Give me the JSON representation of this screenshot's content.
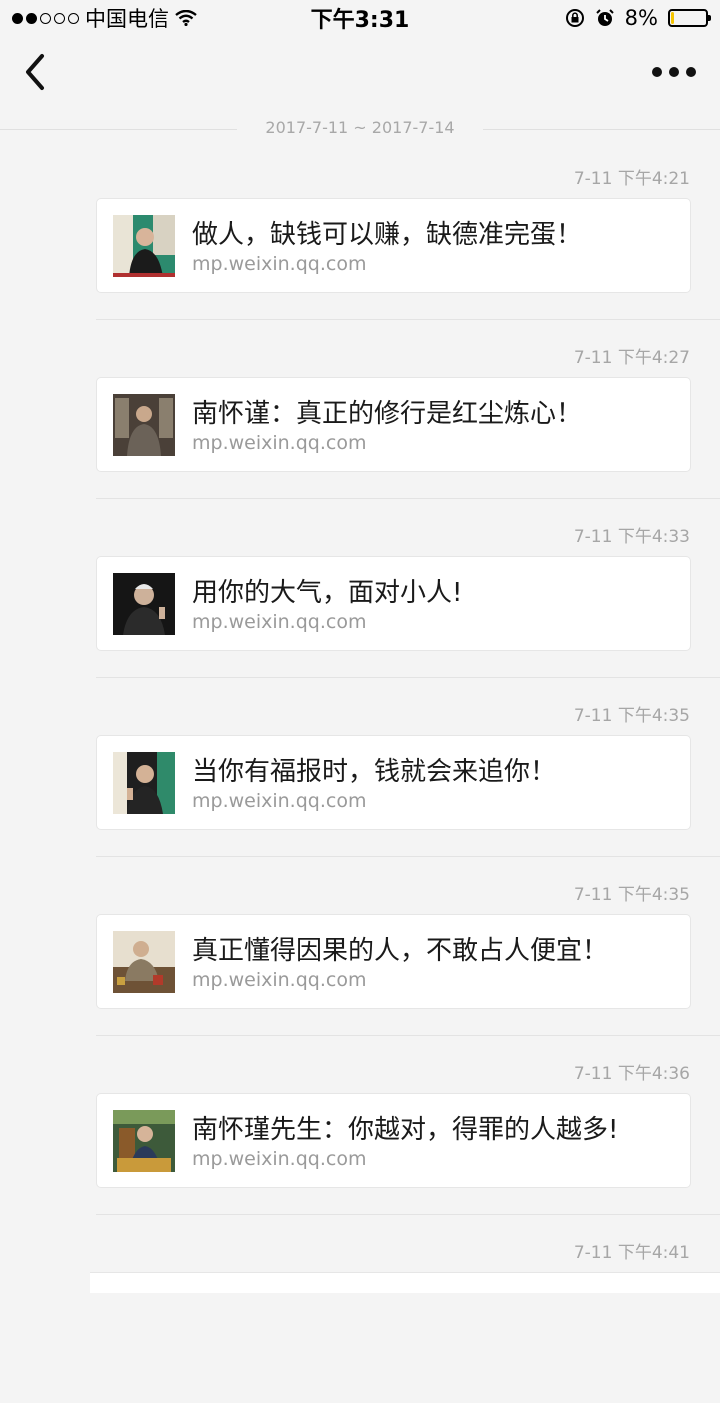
{
  "status_bar": {
    "carrier": "中国电信",
    "time": "下午3:31",
    "battery_percent": "8%",
    "battery_level": 0.08,
    "signal_bars_filled": 2,
    "signal_bars_total": 5,
    "icons": [
      "wifi-icon",
      "rotation-lock-icon",
      "alarm-icon",
      "battery-icon"
    ]
  },
  "nav": {
    "back_icon": "chevron-left-icon",
    "more_icon": "more-dots-icon"
  },
  "date_range": "2017-7-11 ~ 2017-7-14",
  "messages": [
    {
      "time": "7-11 下午4:21",
      "title": "做人，缺钱可以赚，缺德准完蛋！",
      "source": "mp.weixin.qq.com"
    },
    {
      "time": "7-11 下午4:27",
      "title": "南怀谨：真正的修行是红尘炼心！",
      "source": "mp.weixin.qq.com"
    },
    {
      "time": "7-11 下午4:33",
      "title": "用你的大气，面对小人!",
      "source": "mp.weixin.qq.com"
    },
    {
      "time": "7-11 下午4:35",
      "title": "当你有福报时，钱就会来追你！",
      "source": "mp.weixin.qq.com"
    },
    {
      "time": "7-11 下午4:35",
      "title": "真正懂得因果的人，不敢占人便宜！",
      "source": "mp.weixin.qq.com"
    },
    {
      "time": "7-11 下午4:36",
      "title": "南怀瑾先生：你越对，得罪的人越多!",
      "source": "mp.weixin.qq.com"
    },
    {
      "time": "7-11 下午4:41"
    }
  ],
  "colors": {
    "background": "#f4f4f4",
    "card": "#ffffff",
    "muted_text": "#a6a6a6",
    "battery_fill": "#f5c400"
  }
}
